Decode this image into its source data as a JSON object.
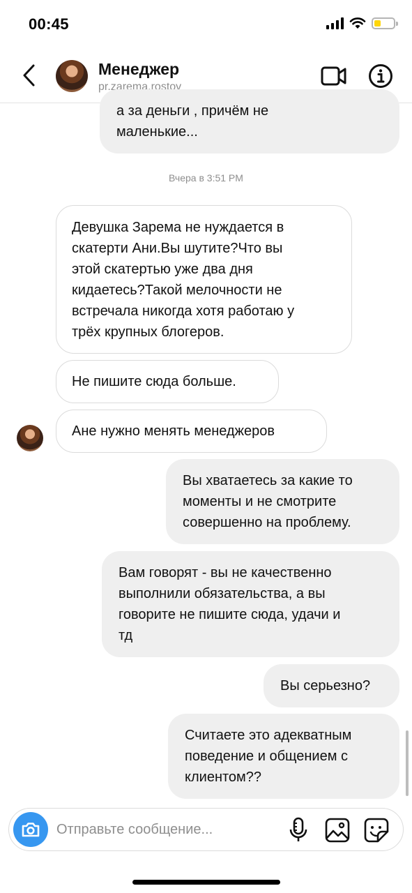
{
  "status_bar": {
    "time": "00:45",
    "battery_level": 0.35,
    "battery_color": "#ffd60a"
  },
  "header": {
    "back_icon": "chevron-left-icon",
    "contact_name": "Менеджер",
    "contact_handle": "pr.zarema.rostov",
    "video_icon": "video-call-icon",
    "info_icon": "info-icon"
  },
  "messages": {
    "m0": {
      "direction": "outgoing",
      "lines": [
        "а за деньги , причём не",
        "маленькие..."
      ]
    },
    "timestamp": "Вчера в 3:51 PM",
    "m1": {
      "direction": "incoming",
      "lines": [
        "Девушка Зарема не нуждается в",
        "скатерти Ани.Вы шутите?Что вы",
        "этой скатертью уже два дня",
        "кидаетесь?Такой мелочности не",
        "встречала никогда хотя работаю у",
        "трёх крупных блогеров."
      ]
    },
    "m2": {
      "direction": "incoming",
      "lines": [
        "Не пишите сюда больше."
      ]
    },
    "m3": {
      "direction": "incoming",
      "lines": [
        "Ане нужно менять менеджеров"
      ]
    },
    "m4": {
      "direction": "outgoing",
      "lines": [
        "Вы хватаетесь за какие то",
        "моменты и не смотрите",
        "совершенно на проблему."
      ]
    },
    "m5": {
      "direction": "outgoing",
      "lines": [
        "Вам говорят - вы не качественно",
        "выполнили обязательства, а вы",
        "говорите не пишите сюда, удачи и",
        "тд"
      ]
    },
    "m6": {
      "direction": "outgoing",
      "lines": [
        "Вы серьезно?"
      ]
    },
    "m7": {
      "direction": "outgoing",
      "lines": [
        "Считаете это адекватным",
        "поведение и общением с",
        "клиентом??"
      ]
    }
  },
  "composer": {
    "placeholder": "Отправьте сообщение...",
    "value": "",
    "camera_icon": "camera-icon",
    "mic_icon": "microphone-icon",
    "gallery_icon": "image-gallery-icon",
    "sticker_icon": "sticker-icon",
    "accent_color": "#3797f0"
  },
  "colors": {
    "incoming_bubble_border": "#dbdbdb",
    "outgoing_bubble_bg": "#efefef",
    "muted_text": "#8e8e8e"
  }
}
